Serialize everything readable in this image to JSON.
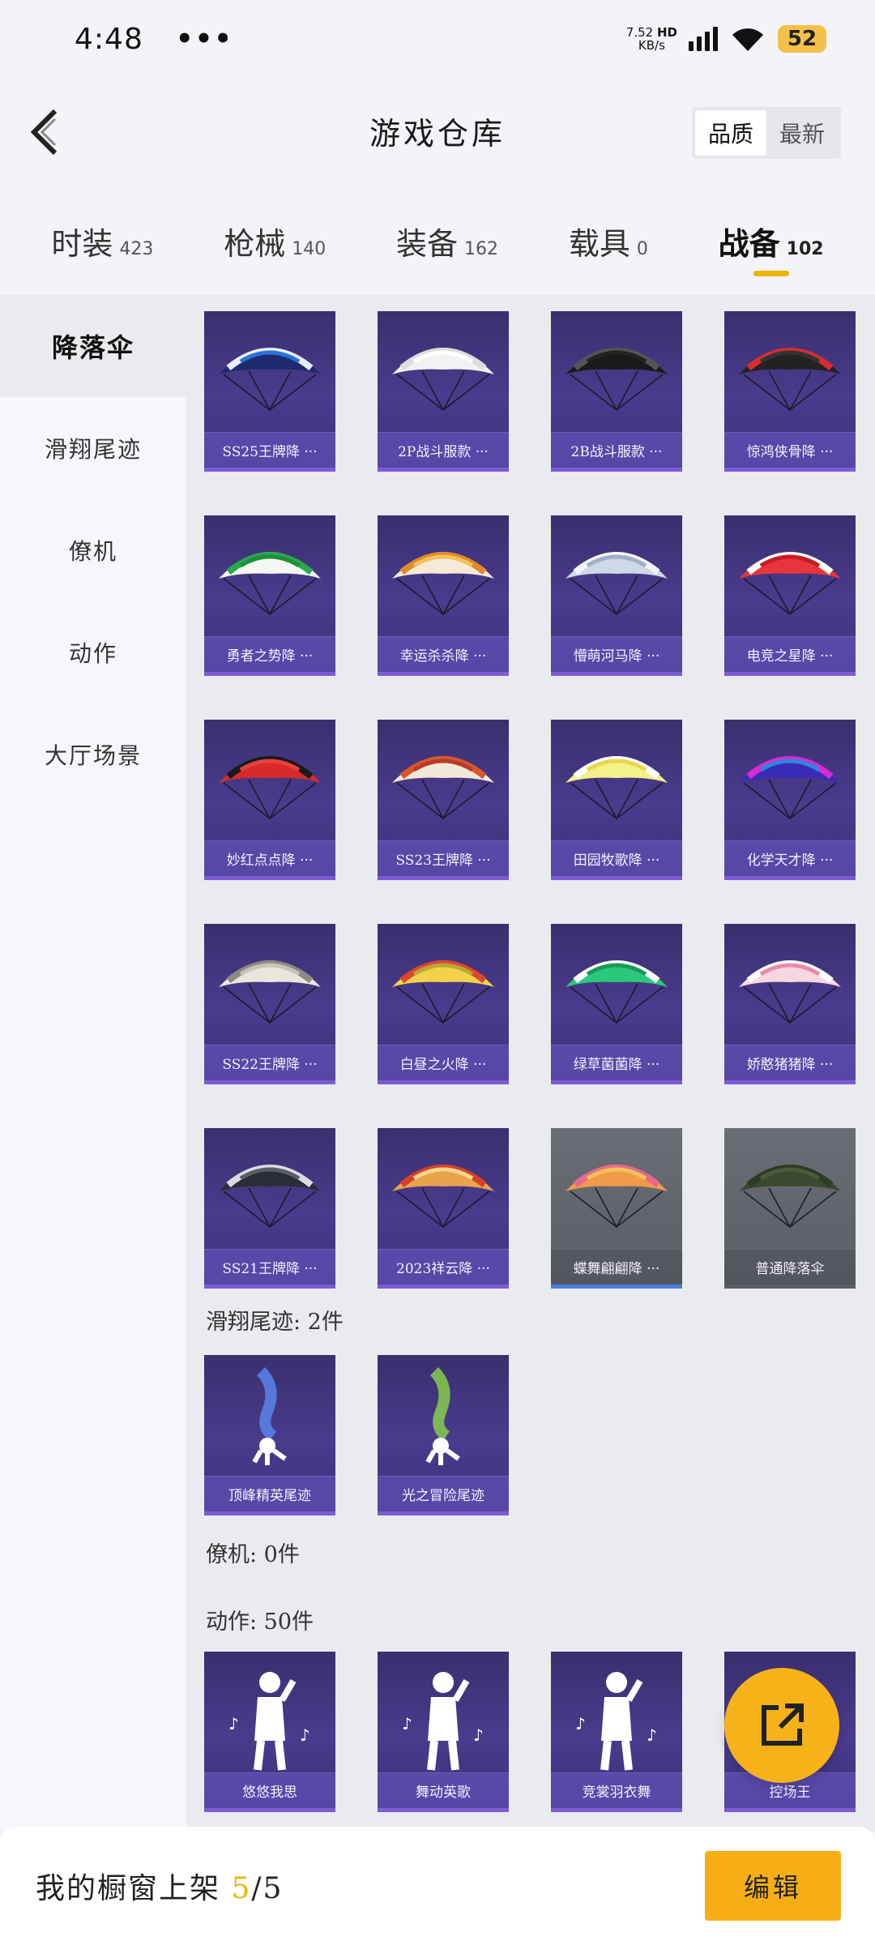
{
  "status_bar": {
    "time": "4:48",
    "dots": "•••",
    "net_speed": "7.52",
    "net_unit": "KB/s",
    "net_type": "HD",
    "battery": "52"
  },
  "header": {
    "title": "游戏仓库",
    "sort_options": [
      "品质",
      "最新"
    ],
    "active_sort": "品质"
  },
  "tabs": [
    {
      "label": "时装",
      "count": "423"
    },
    {
      "label": "枪械",
      "count": "140"
    },
    {
      "label": "装备",
      "count": "162"
    },
    {
      "label": "载具",
      "count": "0"
    },
    {
      "label": "战备",
      "count": "102"
    }
  ],
  "active_tab": "战备",
  "sidebar": {
    "items": [
      "降落伞",
      "滑翔尾迹",
      "僚机",
      "动作",
      "大厅场景"
    ],
    "active": "降落伞"
  },
  "parachutes": [
    "SS25王牌降 ···",
    "2P战斗服款 ···",
    "2B战斗服款 ···",
    "惊鸿侠骨降 ···",
    "勇者之势降 ···",
    "幸运杀杀降 ···",
    "懵萌河马降 ···",
    "电竞之星降 ···",
    "妙红点点降 ···",
    "SS23王牌降 ···",
    "田园牧歌降 ···",
    "化学天才降 ···",
    "SS22王牌降 ···",
    "白昼之火降 ···",
    "绿草菌菌降 ···",
    "娇憨猪猪降 ···",
    "SS21王牌降 ···",
    "2023祥云降 ···",
    "蝶舞翩翩降 ···",
    "普通降落伞"
  ],
  "sections": {
    "trails_title": "滑翔尾迹: 2件",
    "trails": [
      "顶峰精英尾迹",
      "光之冒险尾迹"
    ],
    "wingman_title": "僚机: 0件",
    "emotes_title": "动作: 50件",
    "emotes": [
      "悠悠我思",
      "舞动英歌",
      "竞裳羽衣舞",
      "控场王"
    ]
  },
  "bottom_bar": {
    "showcase_label": "我的橱窗上架 ",
    "showcase_current": "5",
    "showcase_total": "/5",
    "edit_label": "编辑"
  },
  "colors": {
    "accent": "#f0b400",
    "card_bg": "#3f3380",
    "card_label_bg": "#6e5ac8",
    "card_gray_bg": "#5e6168"
  }
}
